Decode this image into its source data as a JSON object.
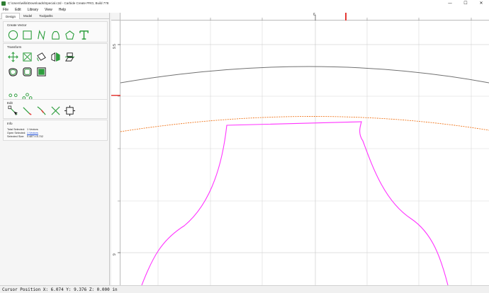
{
  "window": {
    "title": "C:\\Users\\willa\\Downloads\\Special.c2d - Carbide Create PRO, Build 778",
    "controls": {
      "minimize": "—",
      "maximize": "☐",
      "close": "✕"
    }
  },
  "menu": [
    "File",
    "Edit",
    "Library",
    "View",
    "Help"
  ],
  "tabs": [
    {
      "label": "Design",
      "active": true
    },
    {
      "label": "Model",
      "active": false
    },
    {
      "label": "Toolpaths",
      "active": false
    }
  ],
  "sections": {
    "create_vector": {
      "title": "Create Vector",
      "tools": [
        "circle-icon",
        "rectangle-icon",
        "polyline-icon",
        "curve-icon",
        "polygon-icon",
        "text-icon"
      ]
    },
    "transform": {
      "title": "Transform",
      "row1": [
        "move-icon",
        "scale-icon",
        "rotate-icon",
        "mirror-icon",
        "align-icon"
      ],
      "row2": [
        "offset-icon",
        "fillet-icon",
        "boolean-icon"
      ],
      "row3": [
        "circular-array-icon",
        "rectangular-array-icon"
      ]
    },
    "edit": {
      "title": "Edit",
      "tools": [
        "node-edit-icon",
        "extend-icon",
        "fillet-node-icon",
        "trim-icon",
        "bounding-box-icon"
      ]
    },
    "info": {
      "title": "Info",
      "rows": [
        {
          "label": "Total Selected:",
          "value": "1 Vectors",
          "link": false
        },
        {
          "label": "Open Selected:",
          "value": "1 Vectors",
          "link": true
        },
        {
          "label": "Selected Size:",
          "value": "0.487 x 8.702",
          "link": false
        }
      ]
    }
  },
  "rulers": {
    "h_label": "6",
    "v_labels": [
      "9.5",
      "9"
    ]
  },
  "status": {
    "text": "Cursor Position X: 6.074 Y: 9.376 Z: 0.000 in"
  },
  "colors": {
    "accent_green": "#2e9e3e",
    "cursor_red": "#e53935",
    "grey_curve": "#707070",
    "orange_curve": "#f07820",
    "magenta_curve": "#ff33ff"
  }
}
